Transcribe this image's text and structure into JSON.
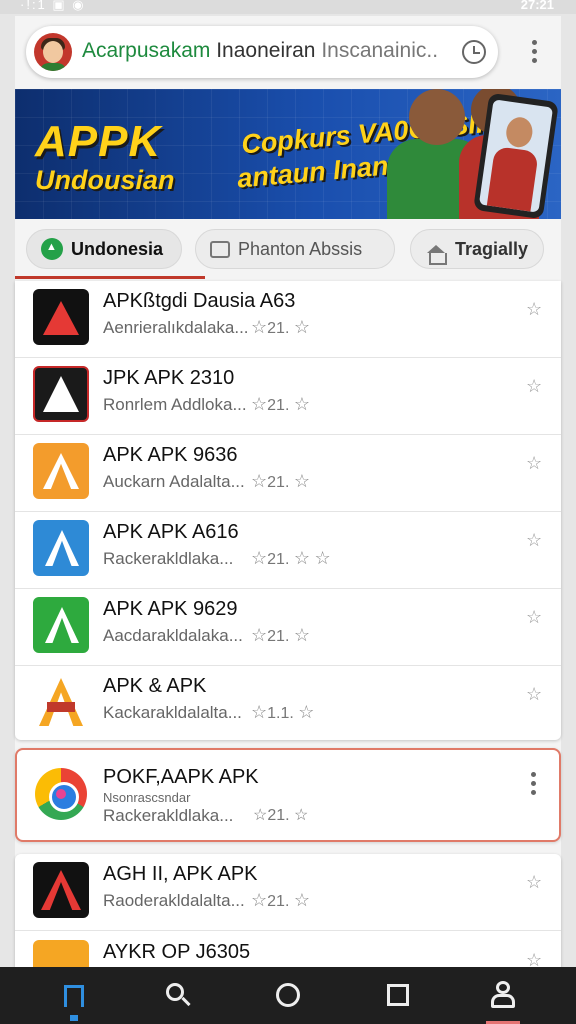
{
  "status_bar": {
    "left": "·!:1 ▣ ◉",
    "time": "27:21"
  },
  "search": {
    "text_highlight": "Acarpusakam",
    "text_main": " Inaoneiran ",
    "text_tail": "Inscanainic.."
  },
  "banner": {
    "title": "APPK",
    "subtitle": "Undousian",
    "slogan_line1": "Copkurs VA0OOSII",
    "slogan_line2": "antaun Inanice!"
  },
  "tabs": [
    {
      "label": "Undonesia",
      "icon": "android-icon"
    },
    {
      "label": "Phanton Abssis",
      "icon": "window-icon"
    },
    {
      "label": "Tragially",
      "icon": "home-icon"
    }
  ],
  "apps": [
    {
      "title": "APKßtgdi Dausia A63",
      "subtitle": "Aenrieralıkdalaka...",
      "rating": "21.",
      "icon": "app-icon-red-a"
    },
    {
      "title": "JPK APK 2310",
      "subtitle": "Ronrlem Addloka...",
      "rating": "21.",
      "icon": "app-icon-dark-a"
    },
    {
      "title": "APK APK 9636",
      "subtitle": "Auckarn Adalalta...",
      "rating": "21.",
      "icon": "app-icon-orange-a"
    },
    {
      "title": "APK APK A616",
      "subtitle": "Rackerakldlaka...",
      "rating": "21.",
      "icon": "app-icon-blue-a"
    },
    {
      "title": "APK APK 9629",
      "subtitle": "Aacdarakldalaka...",
      "rating": "21.",
      "icon": "app-icon-green-a"
    },
    {
      "title": "APK & APK",
      "subtitle": "Kackarakldalalta...",
      "rating": "1.1.",
      "icon": "app-icon-yellow-a"
    }
  ],
  "featured": {
    "title": "POKF,AAPK APK",
    "subtitle_small": "Nsonrascsndar",
    "subtitle": "Rackerakldlaka...",
    "rating": "21.",
    "icon": "chrome-icon"
  },
  "more_apps": [
    {
      "title": "AGH II, APK APK",
      "subtitle": "Raoderakldalalta...",
      "rating": "21.",
      "icon": "app-icon-black-red-a"
    },
    {
      "title": "AYKR OP J6305",
      "subtitle": "",
      "rating": "",
      "icon": "app-icon-orange-a"
    }
  ],
  "nav": [
    "home-icon",
    "search-icon",
    "circle-home-icon",
    "recents-icon",
    "account-icon"
  ]
}
